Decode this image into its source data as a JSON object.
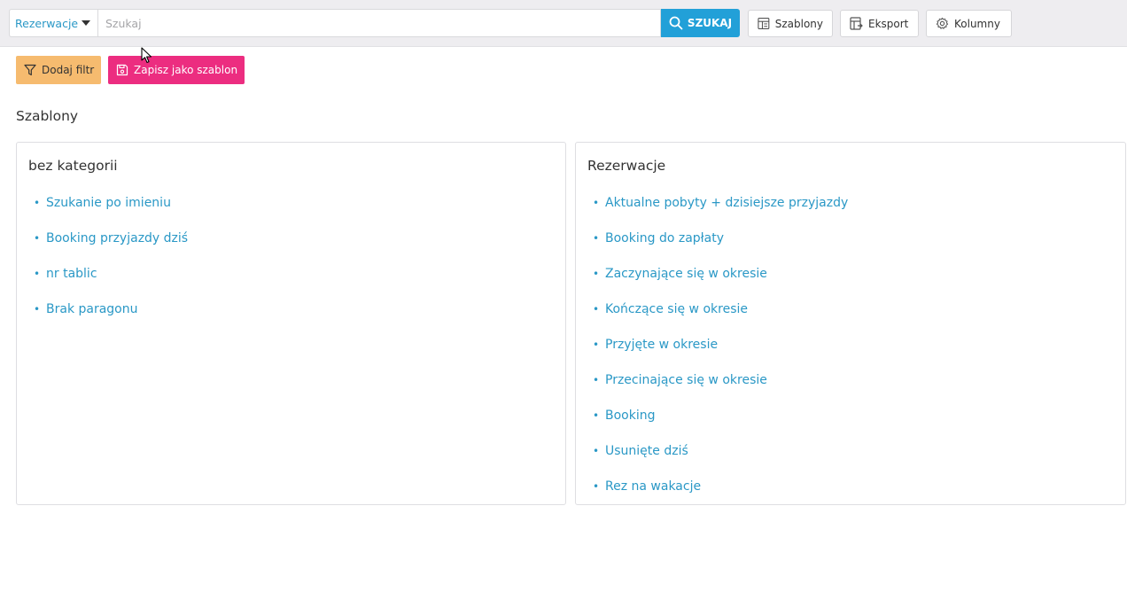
{
  "topbar": {
    "scope_label": "Rezerwacje",
    "search_placeholder": "Szukaj",
    "search_button": "SZUKAJ",
    "templates_button": "Szablony",
    "export_button": "Eksport",
    "columns_button": "Kolumny"
  },
  "actions": {
    "add_filter": "Dodaj filtr",
    "save_template": "Zapisz jako szablon"
  },
  "section_title": "Szablony",
  "categories": [
    {
      "title": "bez kategorii",
      "items": [
        "Szukanie po imieniu",
        "Booking przyjazdy dziś",
        "nr tablic",
        "Brak paragonu"
      ]
    },
    {
      "title": "Rezerwacje",
      "items": [
        "Aktualne pobyty + dzisiejsze przyjazdy",
        "Booking do zapłaty",
        "Zaczynające się w okresie",
        "Kończące się w okresie",
        "Przyjęte w okresie",
        "Przecinające się w okresie",
        "Booking",
        "Usunięte dziś",
        "Rez na wakacje"
      ]
    }
  ],
  "colors": {
    "accent": "#22a0d8",
    "link": "#2a98c6",
    "filter_button": "#f6bb6f",
    "save_button": "#ec2d80"
  },
  "icons": {
    "search": "search-icon",
    "templates": "templates-icon",
    "export": "export-icon",
    "columns": "gear-icon",
    "filter": "filter-icon",
    "save": "save-icon"
  }
}
